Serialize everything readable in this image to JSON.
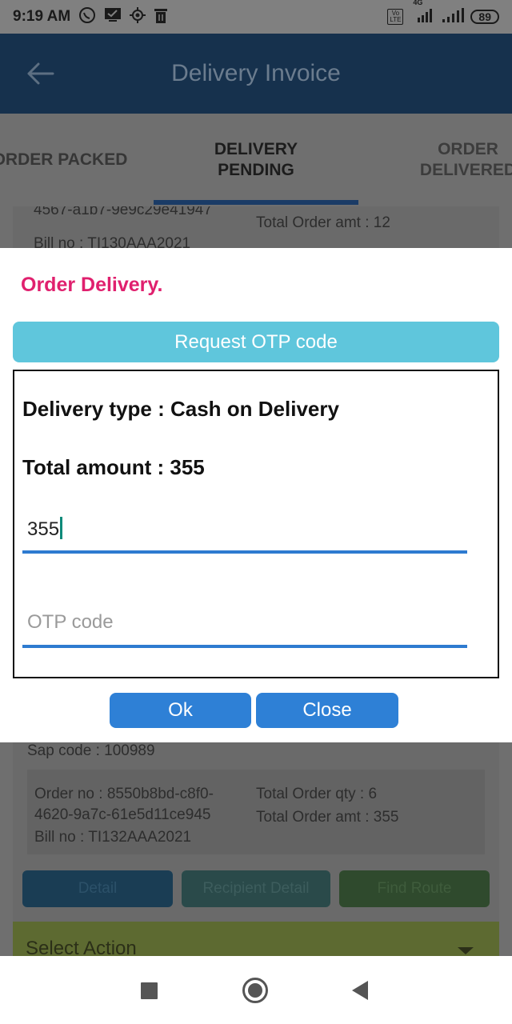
{
  "status_bar": {
    "time": "9:19 AM",
    "network_label": "4G",
    "lte_label": "Vo\nLTE",
    "battery": "89",
    "icons": [
      "whatsapp-icon",
      "check-message-icon",
      "location-icon",
      "trash-icon",
      "signal-icon",
      "signal-icon"
    ]
  },
  "app_bar": {
    "title": "Delivery Invoice",
    "back_icon": "arrow-left-icon"
  },
  "tabs": [
    {
      "label": "ORDER PACKED"
    },
    {
      "label": "DELIVERY\nPENDING"
    },
    {
      "label": "ORDER\nDELIVERED"
    }
  ],
  "background_card_top": {
    "order_no_fragment": "4567-a1b7-9e9c29e41947",
    "total_order_amt": "Total Order amt : 12",
    "bill_no": "Bill no : TI130AAA2021"
  },
  "background_card": {
    "sap_code": "Sap code : 100989",
    "order_no_line1": "Order no : 8550b8bd-c8f0-",
    "order_no_line2": "4620-9a7c-61e5d11ce945",
    "bill_no": "Bill no : TI132AAA2021",
    "total_order_qty": "Total Order qty : 6",
    "total_order_amt": "Total Order amt : 355",
    "buttons": {
      "detail": "Detail",
      "recipient_detail": "Recipient  Detail",
      "find_route": "Find Route"
    },
    "select_action": "Select Action"
  },
  "dialog": {
    "title": "Order Delivery.",
    "request_otp_label": "Request OTP code",
    "delivery_type": "Delivery type : Cash on Delivery",
    "total_amount": "Total amount : 355",
    "amount_input_value": "355",
    "otp_placeholder": "OTP code",
    "ok_label": "Ok",
    "close_label": "Close"
  },
  "colors": {
    "dialog_title": "#e0206e",
    "request_otp_button": "#5fc6dc",
    "primary_button": "#2e80d6",
    "input_underline": "#2e7bd0"
  }
}
